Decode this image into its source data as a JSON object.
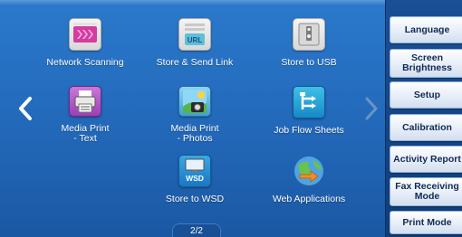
{
  "apps": [
    {
      "label": "Network Scanning",
      "icon": "network-scanning-icon"
    },
    {
      "label": "Store & Send Link",
      "icon": "url-link-icon",
      "badge": "URL"
    },
    {
      "label": "Store to USB",
      "icon": "usb-icon"
    },
    {
      "label": "Media Print\n- Text",
      "icon": "media-print-text-icon"
    },
    {
      "label": "Media Print\n- Photos",
      "icon": "media-print-photos-icon"
    },
    {
      "label": "Job Flow Sheets",
      "icon": "job-flow-icon"
    },
    {
      "label": "Store to WSD",
      "icon": "wsd-icon",
      "badge": "WSD"
    },
    {
      "label": "Web Applications",
      "icon": "web-applications-icon"
    }
  ],
  "navigation": {
    "prev_icon": "chevron-left-icon",
    "next_icon": "chevron-right-icon",
    "page_indicator": "2/2"
  },
  "sidebar": {
    "buttons": [
      {
        "label": "Language"
      },
      {
        "label": "Screen\nBrightness"
      },
      {
        "label": "Setup"
      },
      {
        "label": "Calibration"
      },
      {
        "label": "Activity Report"
      },
      {
        "label": "Fax Receiving\nMode"
      },
      {
        "label": "Print Mode"
      }
    ]
  },
  "colors": {
    "main_background": "#2268b9",
    "sidebar_background": "#0e3d79",
    "button_text": "#102a55",
    "next_arrow_disabled": "#6c93c6"
  }
}
